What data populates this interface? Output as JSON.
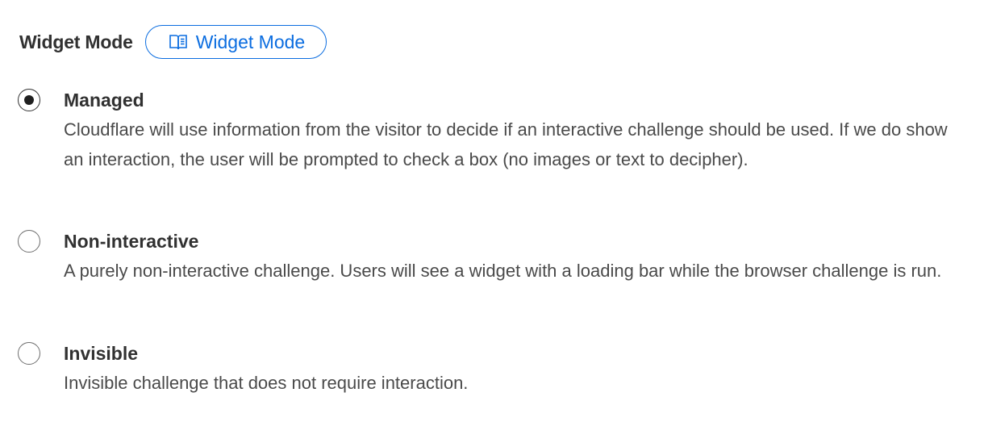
{
  "header": {
    "title": "Widget Mode",
    "doc_link_label": "Widget Mode",
    "doc_link_icon": "book-icon",
    "link_color": "#0b6de0"
  },
  "options": [
    {
      "label": "Managed",
      "description": "Cloudflare will use information from the visitor to decide if an interactive challenge should be used. If we do show an interaction, the user will be prompted to check a box (no images or text to decipher).",
      "selected": true
    },
    {
      "label": "Non-interactive",
      "description": "A purely non-interactive challenge. Users will see a widget with a loading bar while the browser challenge is run.",
      "selected": false
    },
    {
      "label": "Invisible",
      "description": "Invisible challenge that does not require interaction.",
      "selected": false
    }
  ]
}
